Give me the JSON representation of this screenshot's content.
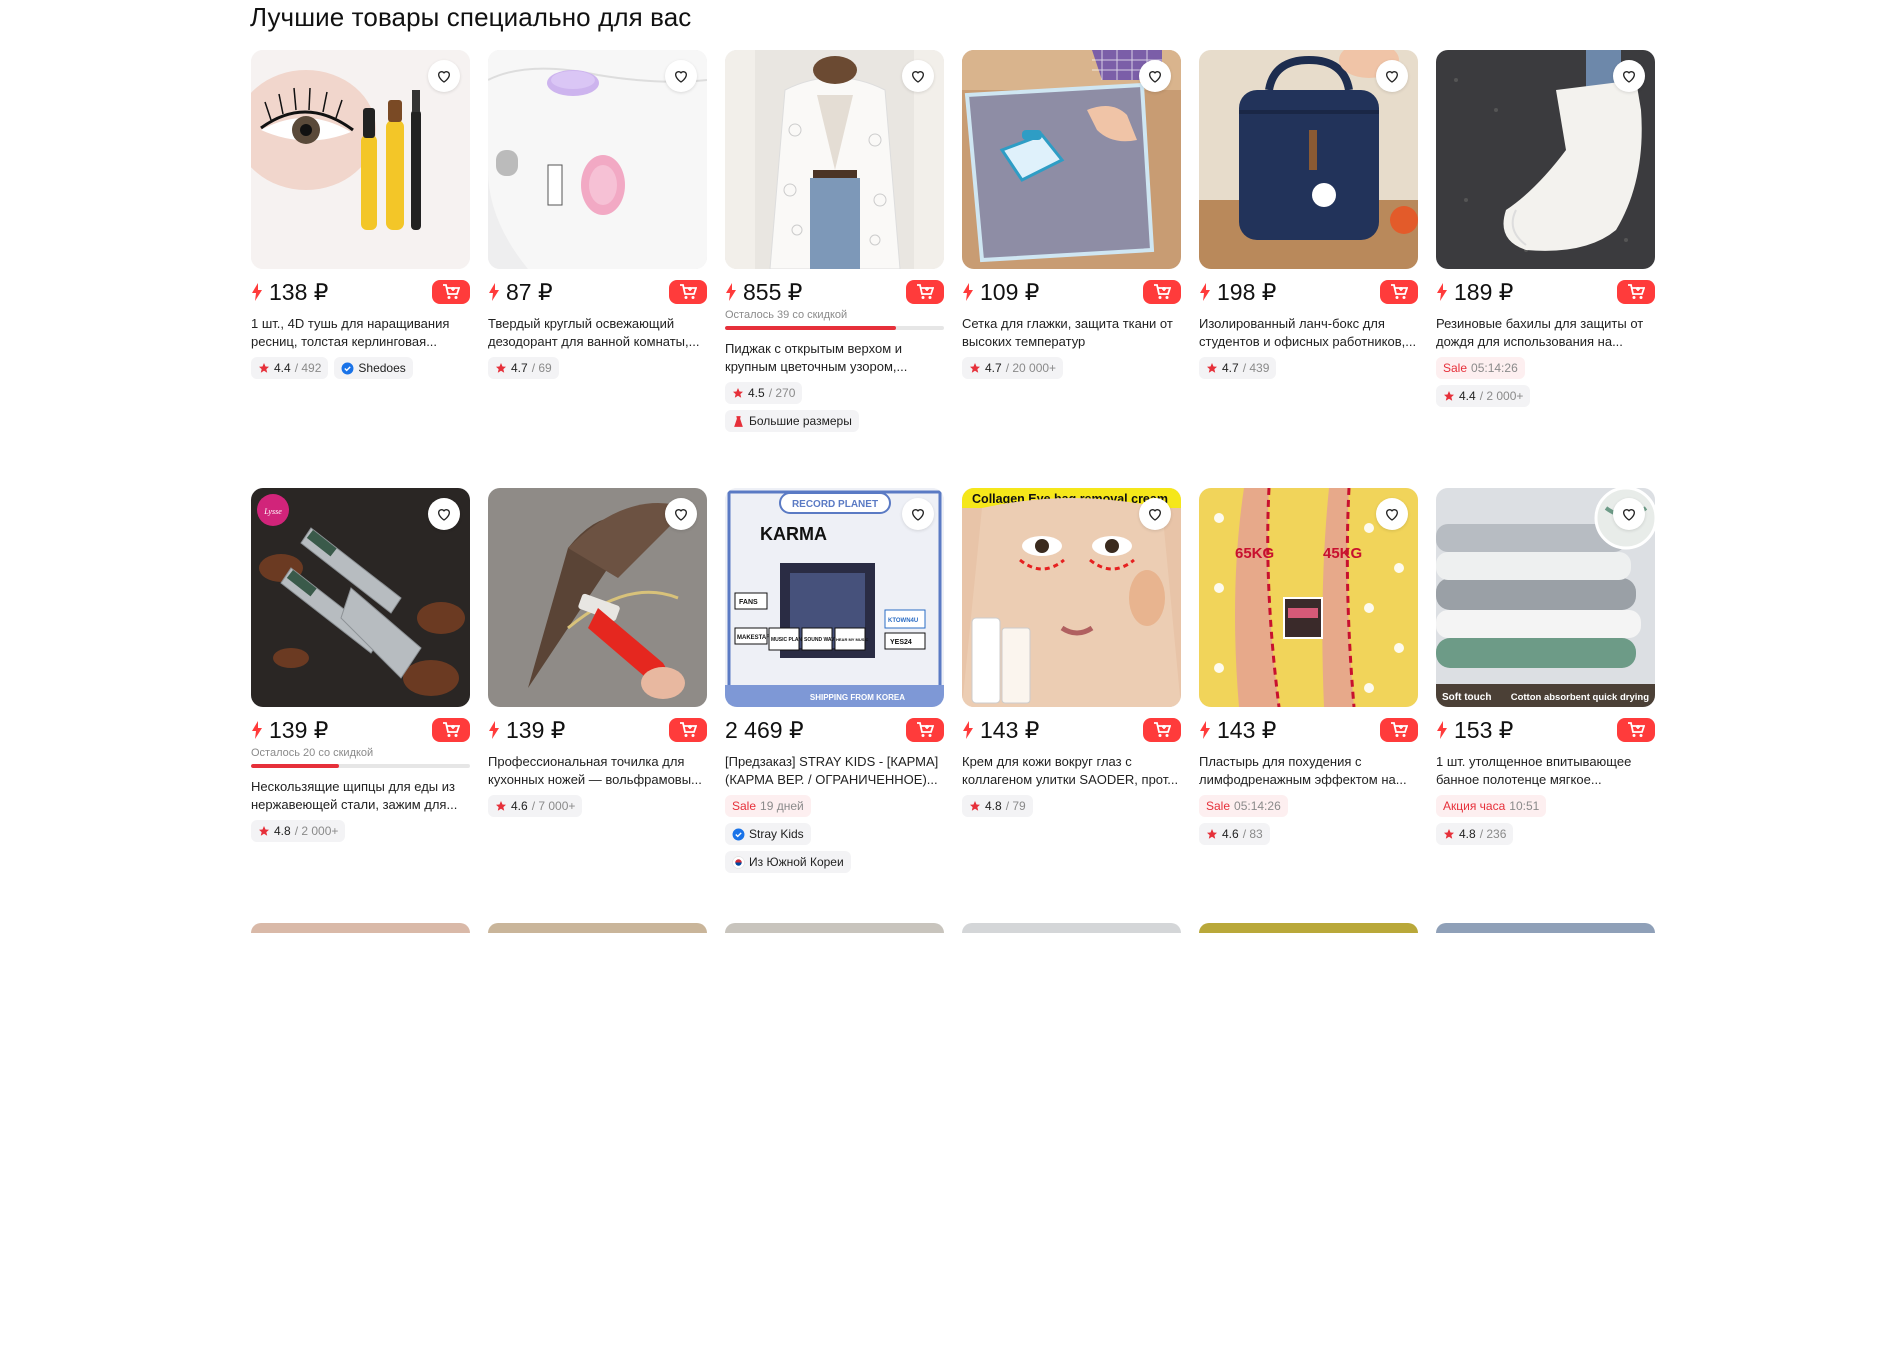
{
  "section_title": "Лучшие товары специально для вас",
  "colors": {
    "accent": "#ff3b3b",
    "sale_text": "#e6303a",
    "chip_bg": "#f3f3f5",
    "verified": "#1a73e8"
  },
  "icons": {
    "favorite": "heart-icon",
    "cart": "cart-icon",
    "bolt": "lightning-icon",
    "star": "star-icon",
    "verified": "verified-check-icon",
    "plus_size": "dress-icon",
    "flag": "korea-flag-icon"
  },
  "products": [
    {
      "price": "138 ₽",
      "title": "1 шт., 4D тушь для наращивания ресниц, толстая керлинговая...",
      "rating": "4.4",
      "reviews": "/ 492",
      "seller": "Shedoes"
    },
    {
      "price": "87 ₽",
      "title": "Твердый круглый освежающий дезодорант для ванной комнаты,...",
      "rating": "4.7",
      "reviews": "/ 69"
    },
    {
      "price": "855 ₽",
      "stock_label": "Осталось 39 со скидкой",
      "stock_fill": 0.78,
      "title": "Пиджак с открытым верхом и крупным цветочным узором,...",
      "rating": "4.5",
      "reviews": "/ 270",
      "tag": "Большие размеры"
    },
    {
      "price": "109 ₽",
      "title": "Сетка для глажки, защита ткани от высоких температур",
      "rating": "4.7",
      "reviews": "/ 20 000+"
    },
    {
      "price": "198 ₽",
      "title": "Изолированный ланч-бокс для студентов и офисных работников,...",
      "rating": "4.7",
      "reviews": "/ 439"
    },
    {
      "price": "189 ₽",
      "title": "Резиновые бахилы для защиты от дождя для использования на...",
      "sale_label": "Sale",
      "sale_time": "05:14:26",
      "rating": "4.4",
      "reviews": "/ 2 000+"
    },
    {
      "price": "139 ₽",
      "stock_label": "Осталось 20 со скидкой",
      "stock_fill": 0.4,
      "title": "Нескользящие щипцы для еды из нержавеющей стали, зажим для...",
      "rating": "4.8",
      "reviews": "/ 2 000+",
      "logo_text": "Lysse"
    },
    {
      "price": "139 ₽",
      "title": "Профессиональная точилка для кухонных ножей — вольфрамовы...",
      "rating": "4.6",
      "reviews": "/ 7 000+"
    },
    {
      "price": "2 469 ₽",
      "title": "[Предзаказ] STRAY KIDS - [КАРМА] (КАРМА ВЕР. / ОГРАНИЧЕННОЕ)...",
      "sale_label": "Sale",
      "sale_time": "19 дней",
      "seller": "Stray Kids",
      "origin": "Из Южной Кореи",
      "overlay": {
        "top": "RECORD PLANET",
        "album": "KARMA",
        "bottom": "SHIPPING FROM KOREA",
        "logos": [
          "FANS",
          "MAKESTAR",
          "MUSIC PLANT",
          "SOUND WAVE",
          "HEAR MY MUSIC",
          "YES24",
          "KTOWN4U"
        ]
      }
    },
    {
      "price": "143 ₽",
      "title": "Крем для кожи вокруг глаз с коллагеном улитки SAODER, прот...",
      "rating": "4.8",
      "reviews": "/ 79",
      "overlay_banner": "Collagen Eye bag removal cream"
    },
    {
      "price": "143 ₽",
      "title": "Пластырь для похудения с лимфодренажным эффектом на...",
      "sale_label": "Sale",
      "sale_time": "05:14:26",
      "rating": "4.6",
      "reviews": "/ 83",
      "overlay_left": "65KG",
      "overlay_right": "45KG"
    },
    {
      "price": "153 ₽",
      "title": "1 шт. утолщенное впитывающее банное полотенце мягкое...",
      "sale_label": "Акция часа",
      "sale_time": "10:51",
      "rating": "4.8",
      "reviews": "/ 236",
      "overlay_left": "Soft touch",
      "overlay_right": "Cotton absorbent quick drying"
    }
  ]
}
